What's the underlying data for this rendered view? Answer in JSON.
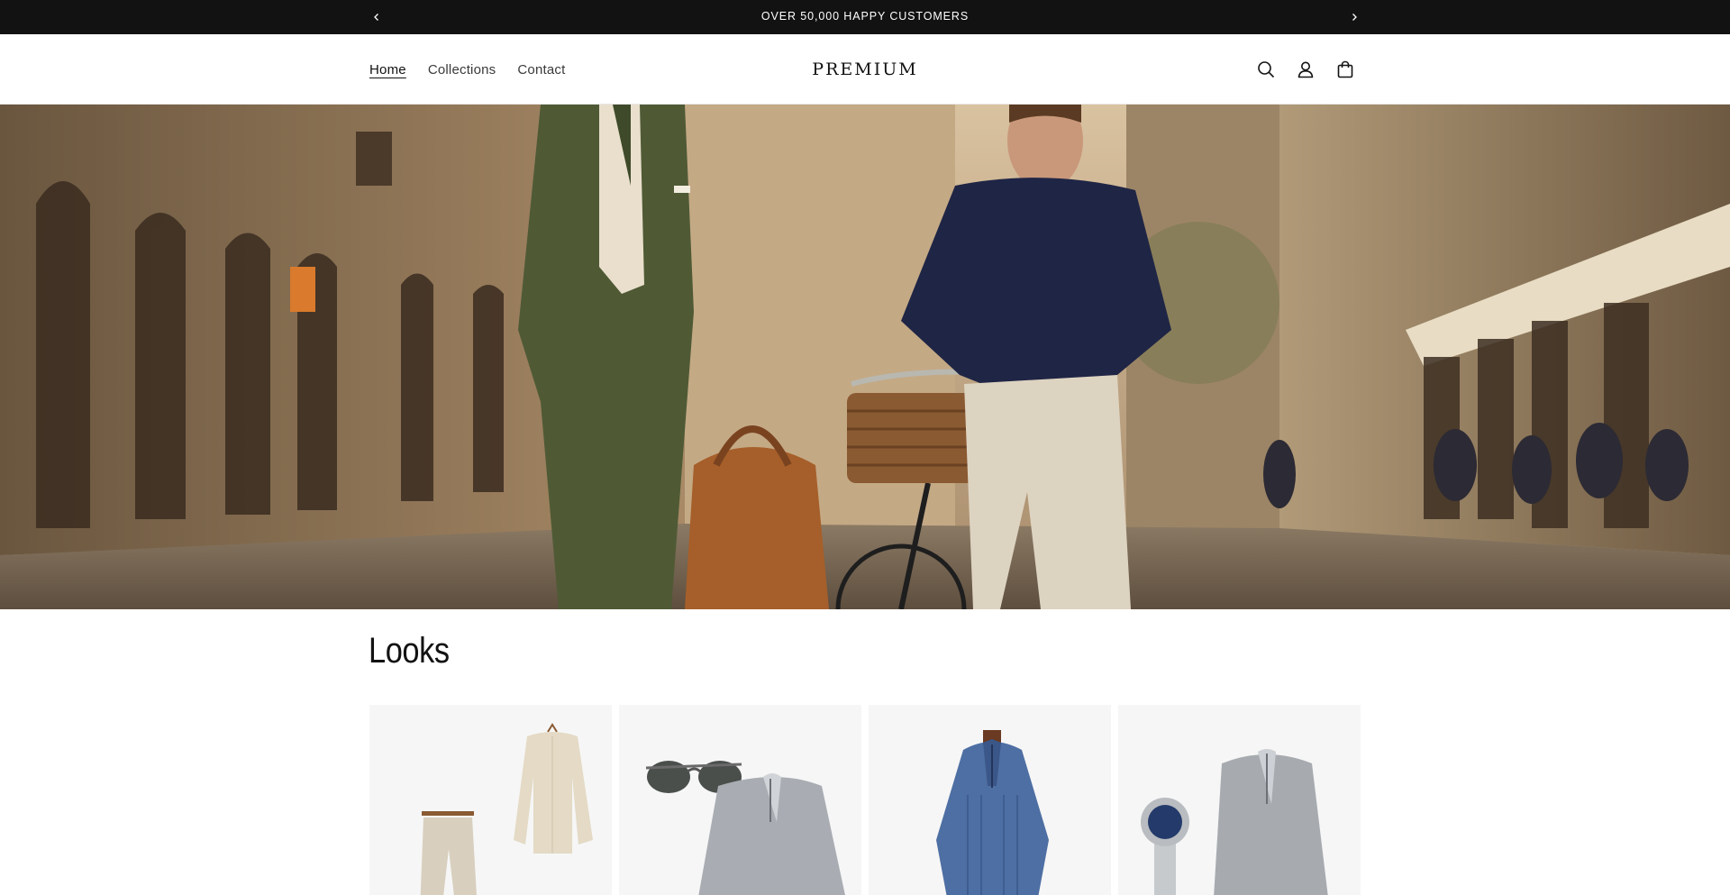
{
  "announcement": {
    "text": "OVER 50,000 HAPPY CUSTOMERS",
    "prev_icon": "chevron-left-icon",
    "next_icon": "chevron-right-icon"
  },
  "header": {
    "nav": [
      {
        "label": "Home",
        "active": true
      },
      {
        "label": "Collections",
        "active": false
      },
      {
        "label": "Contact",
        "active": false
      }
    ],
    "logo": "PREMIUM",
    "icons": [
      "search-icon",
      "account-icon",
      "cart-icon"
    ]
  },
  "hero": {
    "image": "two men walking on european street, green suit with leather bag, navy polo with bicycle"
  },
  "looks": {
    "title": "Looks",
    "cards": [
      {
        "image": "linen shirt and drawstring trousers"
      },
      {
        "image": "sunglasses and grey half-zip sweater"
      },
      {
        "image": "blue cable-knit half-zip sweater"
      },
      {
        "image": "steel watch and grey half-zip sweater"
      }
    ]
  },
  "colors": {
    "announcement_bg": "#121212",
    "text": "#121212",
    "card_bg": "#f6f6f6"
  }
}
